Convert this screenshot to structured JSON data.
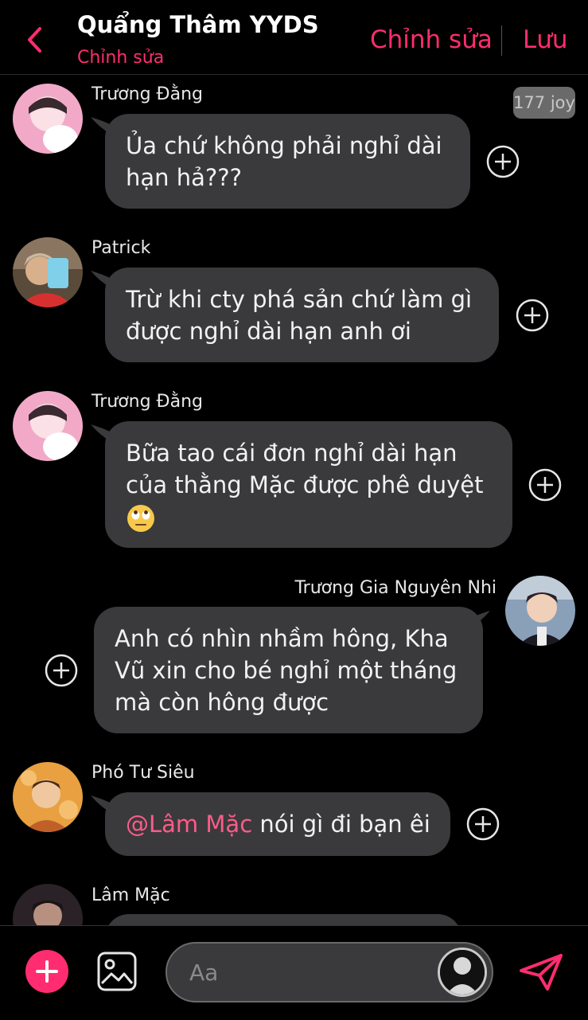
{
  "header": {
    "title": "Quẩng Thâm YYDS",
    "subtitle": "Chỉnh sửa",
    "edit_label": "Chỉnh sửa",
    "save_label": "Lưu"
  },
  "badge": "177 joy",
  "messages": [
    {
      "sender": "Trương Đằng",
      "lines": [
        "Ủa chứ không phải nghỉ dài",
        "hạn hả???"
      ],
      "side": "left"
    },
    {
      "sender": "Patrick",
      "lines": [
        "Trừ khi cty phá sản chứ làm gì",
        "được nghỉ dài hạn anh ơi"
      ],
      "side": "left"
    },
    {
      "sender": "Trương Đằng",
      "lines": [
        "Bữa tao cái đơn nghỉ dài hạn",
        "của thằng Mặc được phê duyệt"
      ],
      "emoji": "face-with-rolling-eyes",
      "side": "left"
    },
    {
      "sender": "Trương Gia Nguyên Nhi",
      "lines": [
        "Anh có nhìn nhầm hông, Kha",
        "Vũ xin cho bé nghỉ một tháng",
        "mà còn hông được"
      ],
      "side": "right"
    },
    {
      "sender": "Phó Tư Siêu",
      "mention": "@Lâm Mặc",
      "text": " nói gì đi bạn êi",
      "side": "left"
    },
    {
      "sender": "Lâm Mặc",
      "side": "left"
    }
  ],
  "composer": {
    "placeholder": "Aa"
  },
  "colors": {
    "accent": "#ff2d6f",
    "bubble": "#3a3a3c",
    "background": "#000000"
  },
  "icons": [
    "back-chevron-icon",
    "plus-circle-icon",
    "image-icon",
    "profile-icon",
    "send-icon"
  ]
}
